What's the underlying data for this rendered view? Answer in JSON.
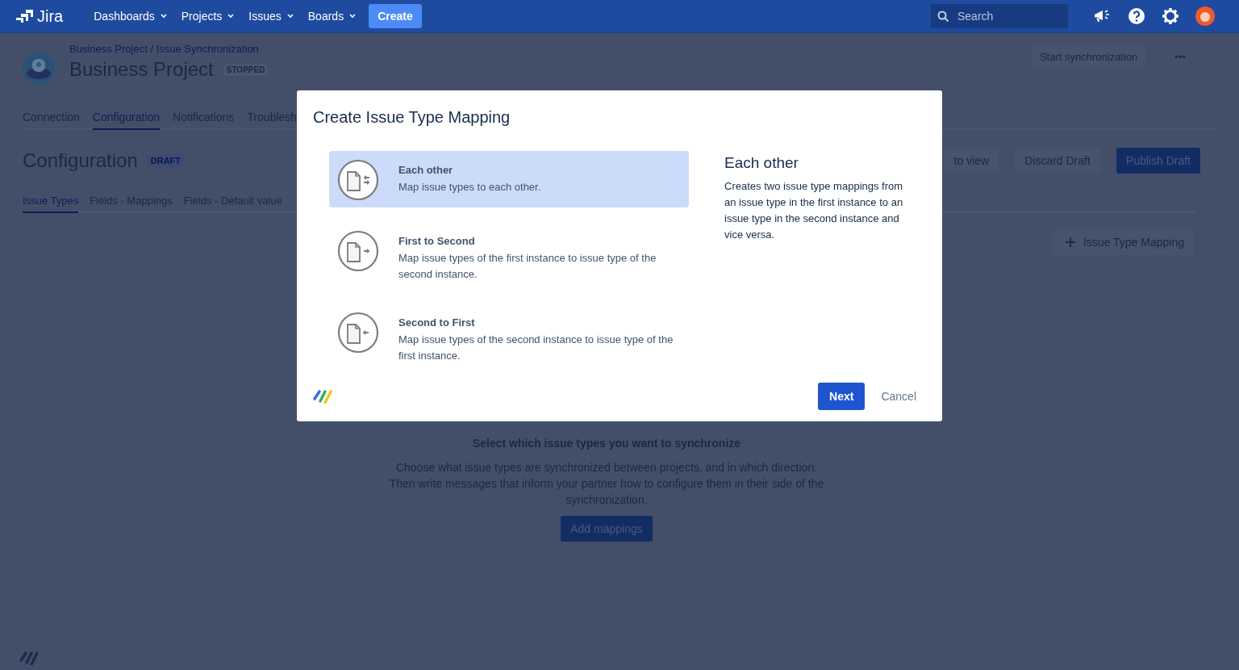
{
  "nav": {
    "logo": "Jira",
    "menus": [
      {
        "label": "Dashboards"
      },
      {
        "label": "Projects"
      },
      {
        "label": "Issues"
      },
      {
        "label": "Boards"
      }
    ],
    "create": "Create",
    "search": {
      "placeholder": "Search"
    }
  },
  "project": {
    "breadcrumb": "Business Project / Issue Synchronization",
    "title": "Business Project",
    "status": "STOPPED",
    "start": "Start synchronization",
    "more": "•••"
  },
  "tabs": [
    {
      "label": "Connection",
      "selected": false
    },
    {
      "label": "Configuration",
      "selected": true
    },
    {
      "label": "Notifications",
      "selected": false
    },
    {
      "label": "Troublesh",
      "selected": false
    }
  ],
  "section": {
    "title": "Configuration",
    "badge": "DRAFT",
    "actions": [
      {
        "label": "to view",
        "kind": "subtle"
      },
      {
        "label": "Discard Draft",
        "kind": "subtle"
      },
      {
        "label": "Publish Draft",
        "kind": "primary"
      }
    ]
  },
  "subtabs": [
    {
      "label": "Issue Types",
      "selected": true
    },
    {
      "label": "Fields - Mappings",
      "selected": false
    },
    {
      "label": "Fields - Default value",
      "selected": false
    }
  ],
  "add_button": "Issue Type Mapping",
  "empty_state": {
    "heading": "Select which issue types you want to synchronize",
    "text": "Choose what issue types are synchronized between projects, and in which direction. Then write messages that inform your partner how to configure them in their side of the synchronization.",
    "button": "Add mappings"
  },
  "modal": {
    "title": "Create Issue Type Mapping",
    "options": [
      {
        "title": "Each other",
        "description": "Map issue types to each other.",
        "kind": "both",
        "selected": true
      },
      {
        "title": "First to Second",
        "description": "Map issue types of the first instance to issue type of the second instance.",
        "kind": "forward",
        "selected": false
      },
      {
        "title": "Second to First",
        "description": "Map issue types of the second instance to issue type of the first instance.",
        "kind": "backward",
        "selected": false
      }
    ],
    "detail": {
      "title": "Each other",
      "text": "Creates two issue type mappings from an issue type in the first instance to an issue type in the second instance and vice versa."
    },
    "next": "Next",
    "cancel": "Cancel"
  }
}
